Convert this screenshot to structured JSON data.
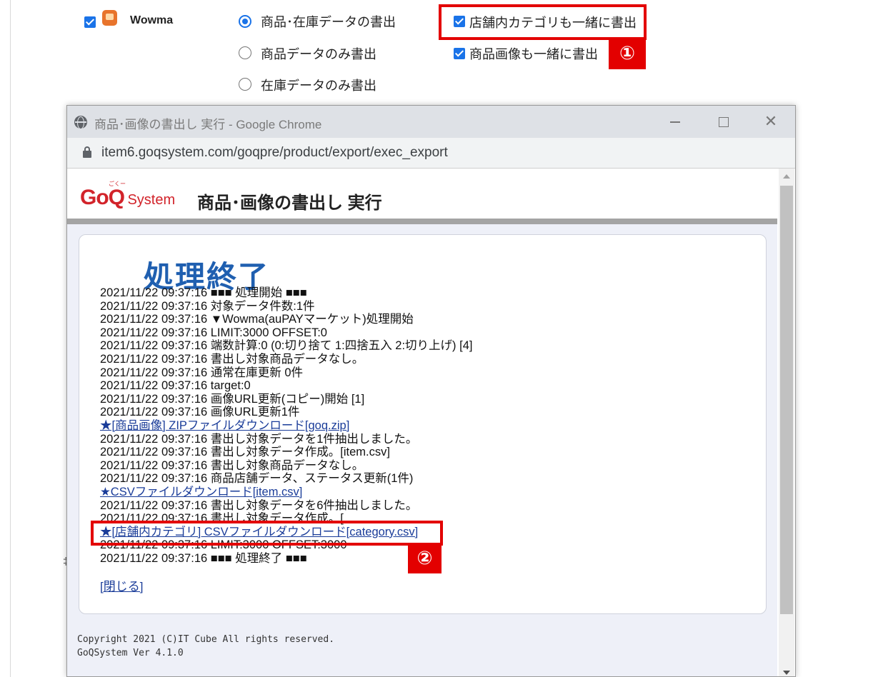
{
  "background": {
    "shop_checkbox_label": "Wowma",
    "export_options": [
      {
        "label": "商品･在庫データの書出",
        "selected": true
      },
      {
        "label": "商品データのみ書出",
        "selected": false
      },
      {
        "label": "在庫データのみ書出",
        "selected": false
      }
    ],
    "extra_options": [
      {
        "label": "店舗内カテゴリも一緒に書出",
        "checked": true
      },
      {
        "label": "商品画像も一緒に書出",
        "checked": true
      }
    ],
    "edge_mark": "‡"
  },
  "callouts": {
    "one": "①",
    "two": "②"
  },
  "window": {
    "title": "商品･画像の書出し 実行 - Google Chrome",
    "url": "item6.goqsystem.com/goqpre/product/export/exec_export",
    "min_label": "",
    "close_label": "✕"
  },
  "page": {
    "logo_main": "GoQ",
    "logo_sub": "System",
    "logo_ruby": "ごくー",
    "title": "商品･画像の書出し 実行",
    "done_heading": "処理終了",
    "log_lines": [
      {
        "text": "2021/11/22 09:37:16 ■■■ 処理開始 ■■■",
        "link": false
      },
      {
        "text": "2021/11/22 09:37:16 対象データ件数:1件",
        "link": false
      },
      {
        "text": "2021/11/22 09:37:16 ▼Wowma(auPAYマーケット)処理開始",
        "link": false
      },
      {
        "text": "2021/11/22 09:37:16 LIMIT:3000 OFFSET:0",
        "link": false
      },
      {
        "text": "2021/11/22 09:37:16 端数計算:0 (0:切り捨て 1:四捨五入 2:切り上げ) [4]",
        "link": false
      },
      {
        "text": "2021/11/22 09:37:16 書出し対象商品データなし。",
        "link": false
      },
      {
        "text": "2021/11/22 09:37:16 通常在庫更新 0件",
        "link": false
      },
      {
        "text": "2021/11/22 09:37:16 target:0",
        "link": false
      },
      {
        "text": "2021/11/22 09:37:16 画像URL更新(コピー)開始 [1]",
        "link": false
      },
      {
        "text": "2021/11/22 09:37:16 画像URL更新1件",
        "link": false
      },
      {
        "text": "★[商品画像] ZIPファイルダウンロード[goq.zip]",
        "link": true
      },
      {
        "text": "2021/11/22 09:37:16 書出し対象データを1件抽出しました。",
        "link": false
      },
      {
        "text": "2021/11/22 09:37:16 書出し対象データ作成。[item.csv]",
        "link": false
      },
      {
        "text": "2021/11/22 09:37:16 書出し対象商品データなし。",
        "link": false
      },
      {
        "text": "2021/11/22 09:37:16 商品店舗データ、ステータス更新(1件)",
        "link": false
      },
      {
        "text": "★CSVファイルダウンロード[item.csv]",
        "link": true
      },
      {
        "text": "2021/11/22 09:37:16 書出し対象データを6件抽出しました。",
        "link": false
      },
      {
        "text": "2021/11/22 09:37:16 書出し対象データ作成。[",
        "link": false
      },
      {
        "text": "★[店舗内カテゴリ] CSVファイルダウンロード[category.csv]",
        "link": true
      },
      {
        "text": "2021/11/22 09:37:16 LIMIT:3000 OFFSET:3000",
        "link": false
      },
      {
        "text": "2021/11/22 09:37:16 ■■■ 処理終了 ■■■",
        "link": false
      }
    ],
    "close_link": "[閉じる]",
    "footer_copyright": "Copyright 2021 (C)IT Cube All rights reserved.",
    "footer_version": "GoQSystem Ver 4.1.0"
  }
}
